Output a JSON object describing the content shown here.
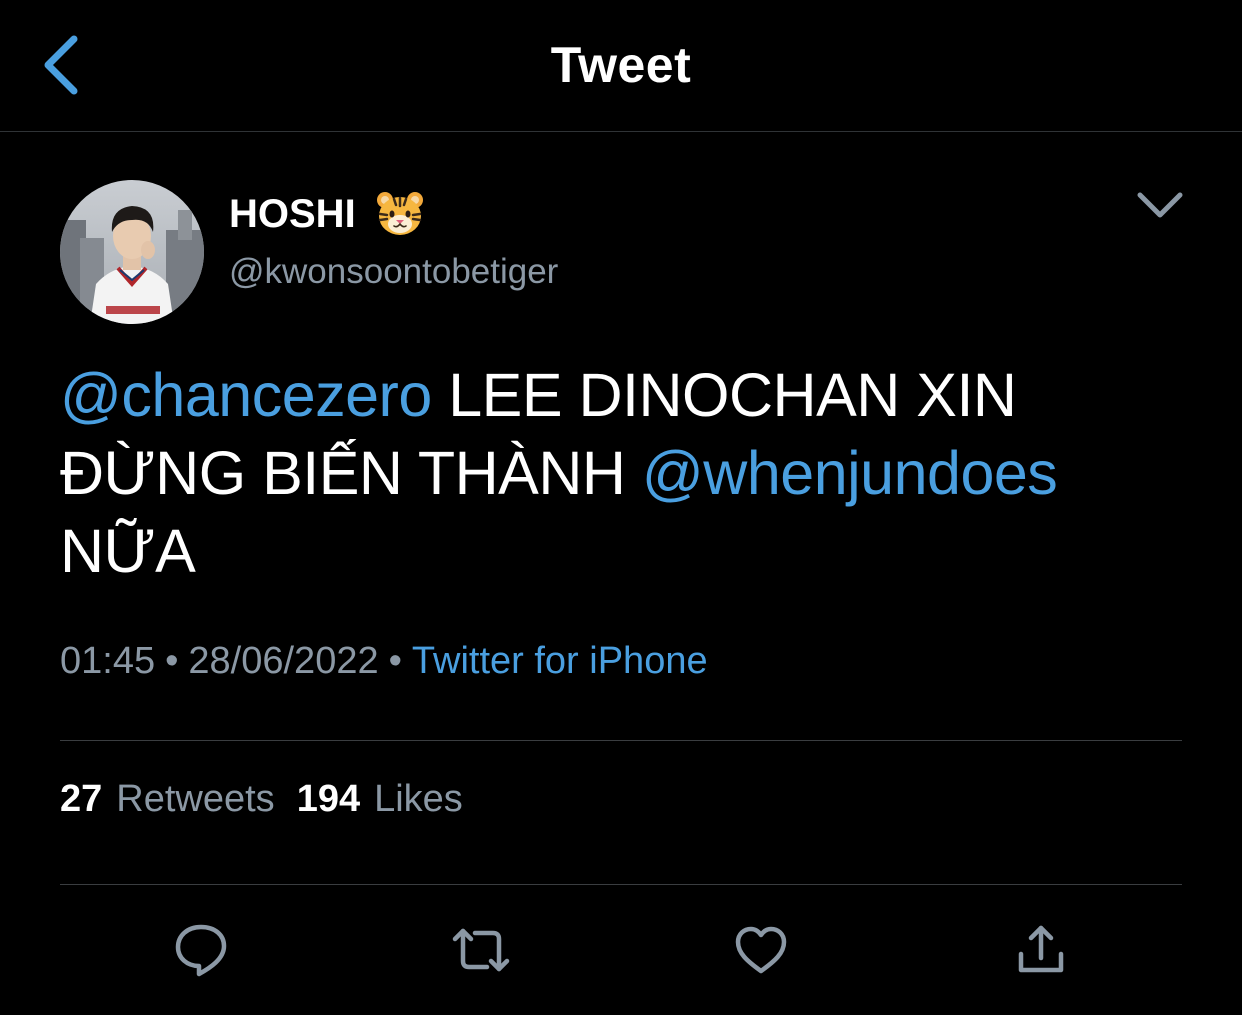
{
  "header": {
    "title": "Tweet",
    "back_icon": "chevron-left-icon"
  },
  "tweet": {
    "author": {
      "display_name": "HOSHI",
      "emoji_icon": "tiger-face-icon",
      "handle": "@kwonsoontobetiger"
    },
    "text_parts": {
      "mention_1": "@chancezero",
      "text_1": " LEE DINOCHAN XIN ĐỪNG BIẾN THÀNH ",
      "mention_2": "@whenjundoes",
      "text_2": " NỮA"
    },
    "time": "01:45",
    "date": "28/06/2022",
    "separator": "•",
    "source": "Twitter for iPhone",
    "stats": {
      "retweets_count": "27",
      "retweets_label": "Retweets",
      "likes_count": "194",
      "likes_label": "Likes"
    }
  },
  "actions": {
    "reply_icon": "reply-icon",
    "retweet_icon": "retweet-icon",
    "like_icon": "heart-icon",
    "share_icon": "share-icon"
  },
  "colors": {
    "background": "#000000",
    "accent": "#4a9fe0",
    "secondary_text": "#8b98a5",
    "divider": "#3a3d40"
  }
}
